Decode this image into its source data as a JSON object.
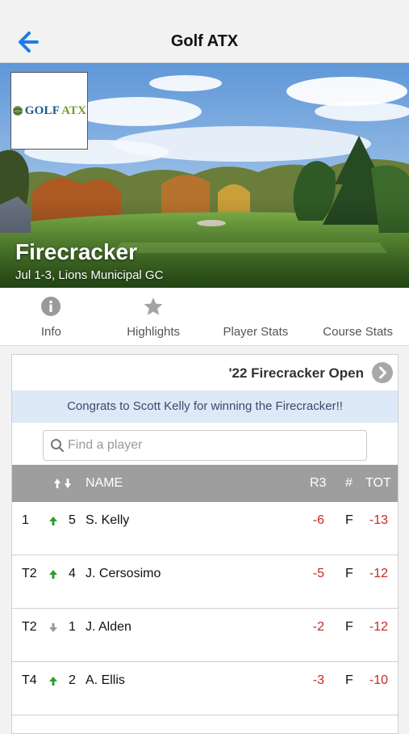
{
  "nav": {
    "title": "Golf ATX",
    "back_icon": "back-arrow-icon"
  },
  "hero": {
    "logo_text_main": "GOLF",
    "logo_text_accent": "ATX",
    "event_name": "Firecracker",
    "event_sub": "Jul 1-3, Lions Municipal GC"
  },
  "tabs": [
    {
      "label": "Info",
      "icon": "info-icon"
    },
    {
      "label": "Highlights",
      "icon": "star-icon"
    },
    {
      "label": "Player Stats",
      "icon": ""
    },
    {
      "label": "Course Stats",
      "icon": ""
    }
  ],
  "card": {
    "event_title": "'22 Firecracker Open",
    "announcement": "Congrats to Scott Kelly for winning the Firecracker!!",
    "search_placeholder": "Find a player"
  },
  "table": {
    "columns": {
      "name": "NAME",
      "r3": "R3",
      "thru": "#",
      "tot": "TOT"
    },
    "rows": [
      {
        "pos": "1",
        "move": "up",
        "move_n": "5",
        "name": "S. Kelly",
        "r3": "-6",
        "thru": "F",
        "tot": "-13"
      },
      {
        "pos": "T2",
        "move": "up",
        "move_n": "4",
        "name": "J. Cersosimo",
        "r3": "-5",
        "thru": "F",
        "tot": "-12"
      },
      {
        "pos": "T2",
        "move": "down",
        "move_n": "1",
        "name": "J. Alden",
        "r3": "-2",
        "thru": "F",
        "tot": "-12"
      },
      {
        "pos": "T4",
        "move": "up",
        "move_n": "2",
        "name": "A. Ellis",
        "r3": "-3",
        "thru": "F",
        "tot": "-10"
      }
    ]
  },
  "colors": {
    "accent_blue": "#1a7ee6",
    "score_red": "#c62828",
    "up_green": "#2e9d2e",
    "down_gray": "#9a9a9a",
    "header_gray": "#9e9e9e",
    "announce_bg": "#dde9f6"
  }
}
